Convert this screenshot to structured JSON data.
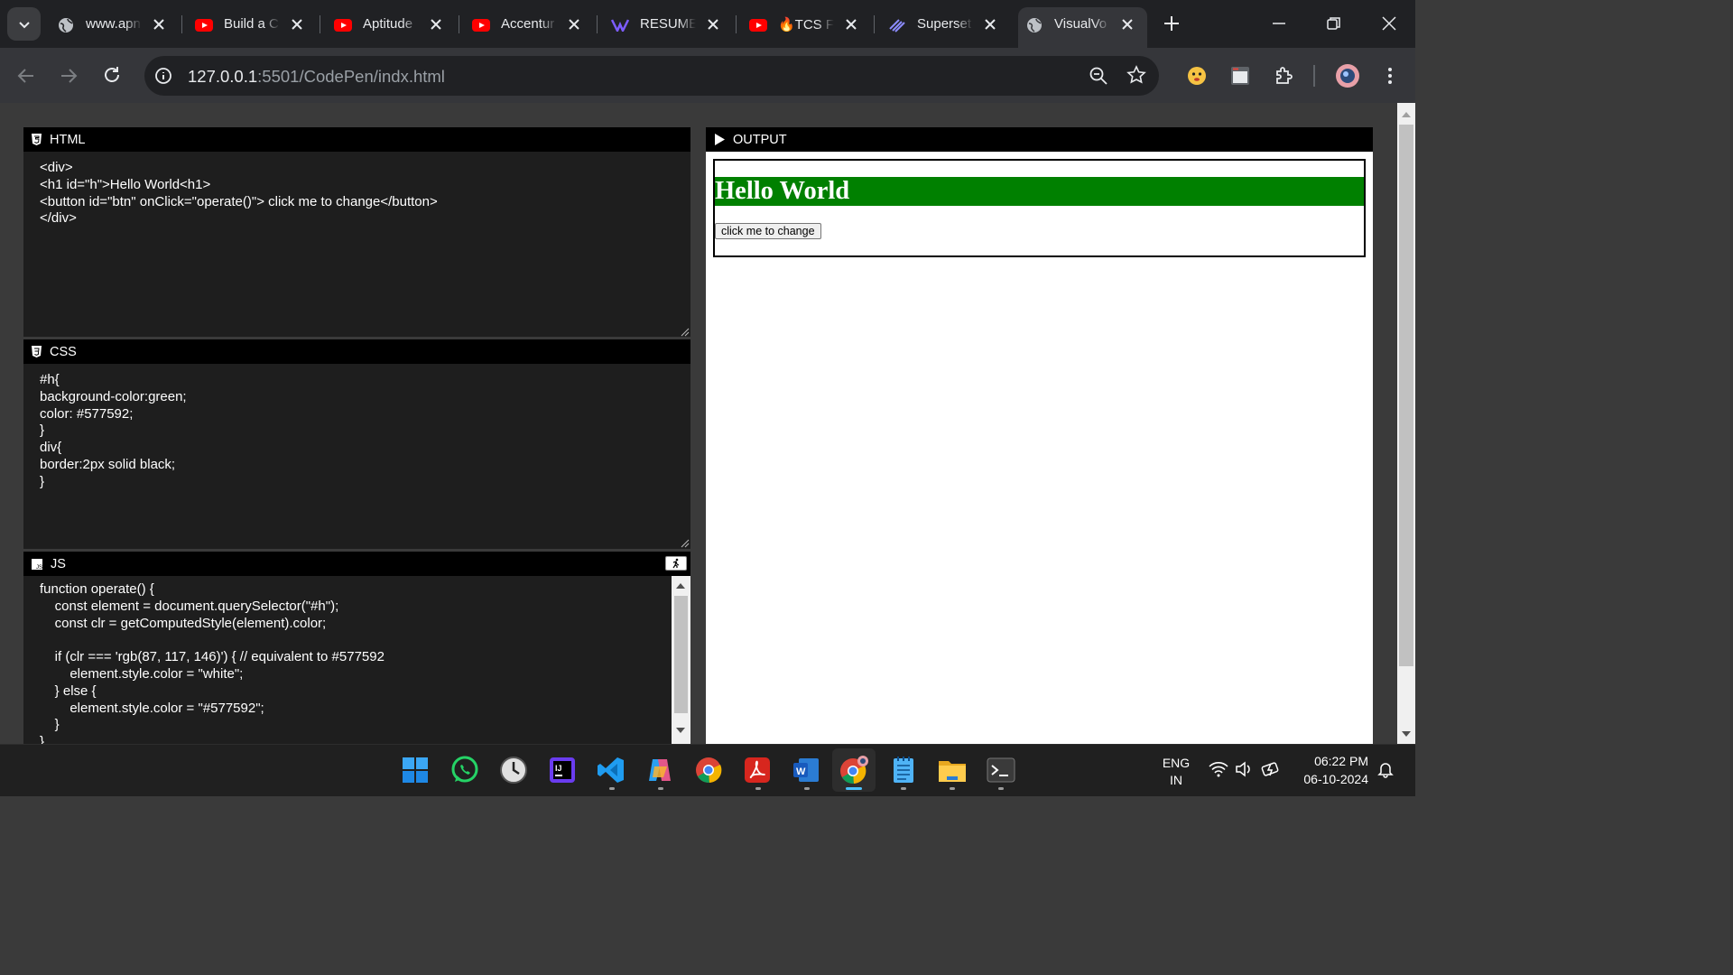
{
  "browser": {
    "tabs": [
      {
        "title": "www.apn",
        "icon": "globe-icon"
      },
      {
        "title": "Build a Cl",
        "icon": "youtube-icon"
      },
      {
        "title": "Aptitude",
        "icon": "youtube-icon"
      },
      {
        "title": "Accentur",
        "icon": "youtube-icon"
      },
      {
        "title": "RESUME",
        "icon": "resume-logo-icon"
      },
      {
        "title": "🔥TCS Fr",
        "icon": "youtube-icon"
      },
      {
        "title": "Superset",
        "icon": "superset-icon"
      },
      {
        "title": "VisualVo",
        "icon": "globe-icon",
        "active": true
      }
    ],
    "url_host": "127.0.0.1",
    "url_path": ":5501/CodePen/indx.html"
  },
  "editor": {
    "html_label": "HTML",
    "html_code": "<div>\n<h1 id=\"h\">Hello World<h1>\n<button id=\"btn\" onClick=\"operate()\"> click me to change</button>\n</div>",
    "css_label": "CSS",
    "css_code": "#h{\nbackground-color:green;\ncolor: #577592;\n}\ndiv{\nborder:2px solid black;\n}",
    "js_label": "JS",
    "js_code": "function operate() {\n    const element = document.querySelector(\"#h\");\n    const clr = getComputedStyle(element).color;\n\n    if (clr === 'rgb(87, 117, 146)') { // equivalent to #577592\n        element.style.color = \"white\";\n    } else {\n        element.style.color = \"#577592\";\n    }\n}",
    "run_icon": "running-person-icon"
  },
  "output": {
    "label": "OUTPUT",
    "heading": "Hello World",
    "button": "click me to change",
    "heading_bg": "#008000",
    "heading_color": "#ffffff"
  },
  "taskbar": {
    "apps": [
      "windows-start-icon",
      "whatsapp-icon",
      "clock-icon",
      "intellij-icon",
      "vscode-icon",
      "copilot-icon",
      "chrome-icon",
      "acrobat-icon",
      "word-icon",
      "chrome-profile-icon",
      "notepad-icon",
      "file-explorer-icon",
      "terminal-icon"
    ],
    "lang_line1": "ENG",
    "lang_line2": "IN",
    "time": "06:22 PM",
    "date": "06-10-2024"
  },
  "colors": {
    "accent": "#008000",
    "chrome_dark": "#202124"
  }
}
